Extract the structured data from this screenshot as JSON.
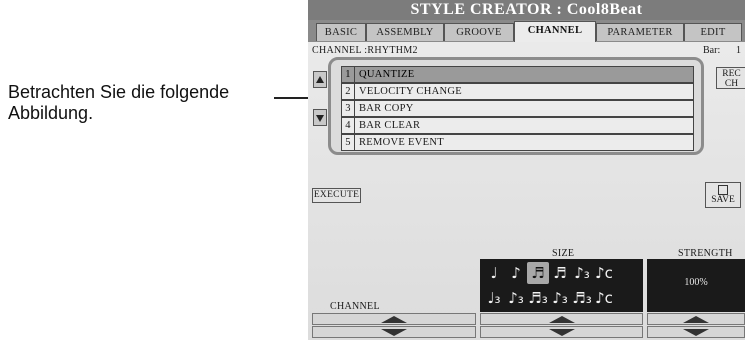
{
  "caption": "Betrachten Sie die folgende Abbildung.",
  "screen": {
    "title": "STYLE CREATOR : Cool8Beat",
    "tabs": [
      {
        "label": "BASIC",
        "active": false
      },
      {
        "label": "ASSEMBLY",
        "active": false
      },
      {
        "label": "GROOVE",
        "active": false
      },
      {
        "label": "CHANNEL",
        "active": true
      },
      {
        "label": "PARAMETER",
        "active": false
      },
      {
        "label": "EDIT",
        "active": false
      }
    ],
    "channel_label": "CHANNEL :RHYTHM2",
    "bar_label": "Bar:",
    "bar_value": "1",
    "menu": [
      {
        "num": "1",
        "label": "QUANTIZE",
        "selected": true
      },
      {
        "num": "2",
        "label": "VELOCITY CHANGE",
        "selected": false
      },
      {
        "num": "3",
        "label": "BAR COPY",
        "selected": false
      },
      {
        "num": "4",
        "label": "BAR CLEAR",
        "selected": false
      },
      {
        "num": "5",
        "label": "REMOVE EVENT",
        "selected": false
      }
    ],
    "rec_ch": {
      "line1": "REC",
      "line2": "CH"
    },
    "execute_label": "EXECUTE",
    "save_label": "SAVE",
    "size_label": "SIZE",
    "strength_label": "STRENGTH",
    "strength_value": "100%",
    "channel_section_label": "CHANNEL",
    "note_sizes": [
      {
        "symbol": "♩",
        "selected": false
      },
      {
        "symbol": "♪",
        "selected": false
      },
      {
        "symbol": "♬",
        "selected": true
      },
      {
        "symbol": "♬",
        "selected": false
      },
      {
        "symbol": "♪₃",
        "selected": false
      },
      {
        "symbol": "♪c",
        "selected": false
      },
      {
        "symbol": "",
        "selected": false
      },
      {
        "symbol": "♩₃",
        "selected": false
      },
      {
        "symbol": "♪₃",
        "selected": false
      },
      {
        "symbol": "♬₃",
        "selected": false
      },
      {
        "symbol": "♪₃",
        "selected": false
      },
      {
        "symbol": "♬₃",
        "selected": false
      },
      {
        "symbol": "♪c",
        "selected": false
      },
      {
        "symbol": "",
        "selected": false
      }
    ]
  }
}
